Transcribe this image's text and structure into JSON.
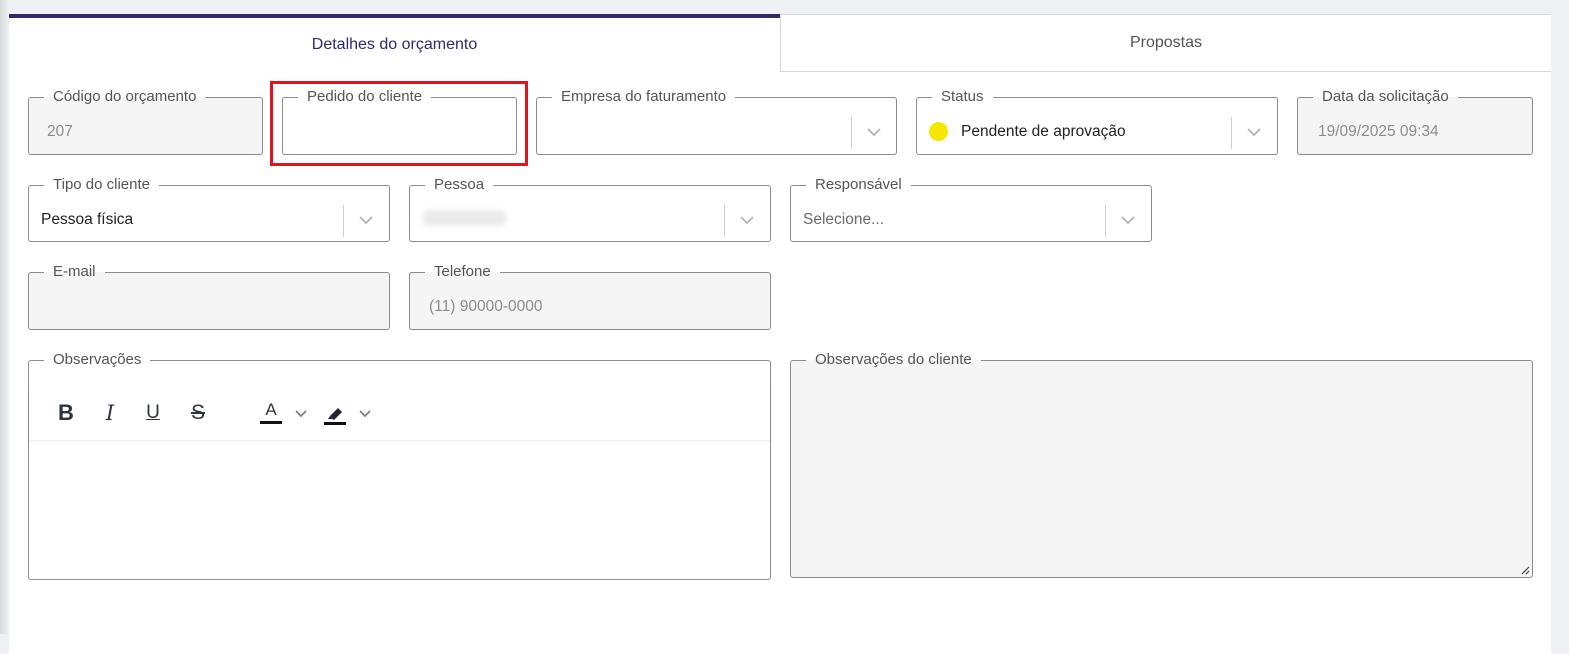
{
  "tabs": [
    {
      "label": "Detalhes do orçamento",
      "active": true
    },
    {
      "label": "Propostas",
      "active": false
    }
  ],
  "fields": {
    "codigo": {
      "label": "Código do orçamento",
      "value": "207"
    },
    "pedido": {
      "label": "Pedido do cliente",
      "value": ""
    },
    "empresa": {
      "label": "Empresa do faturamento",
      "value": ""
    },
    "status": {
      "label": "Status",
      "value": "Pendente de aprovação",
      "dot_color": "#f6e600"
    },
    "data": {
      "label": "Data da solicitação",
      "value": "19/09/2025 09:34"
    },
    "tipo": {
      "label": "Tipo do cliente",
      "value": "Pessoa física"
    },
    "pessoa": {
      "label": "Pessoa",
      "value": ""
    },
    "responsavel": {
      "label": "Responsável",
      "placeholder": "Selecione..."
    },
    "email": {
      "label": "E-mail",
      "value": ""
    },
    "telefone": {
      "label": "Telefone",
      "placeholder": "(11) 90000-0000"
    },
    "observacoes": {
      "label": "Observações"
    },
    "observacoes_cliente": {
      "label": "Observações do cliente"
    }
  },
  "editor_toolbar": {
    "bold": "B",
    "italic": "I",
    "underline": "U",
    "strike": "S",
    "font_color": "A"
  },
  "colors": {
    "tab_accent": "#2e2a6e",
    "highlight_border": "#e0141c",
    "status_pending": "#f6e600"
  }
}
